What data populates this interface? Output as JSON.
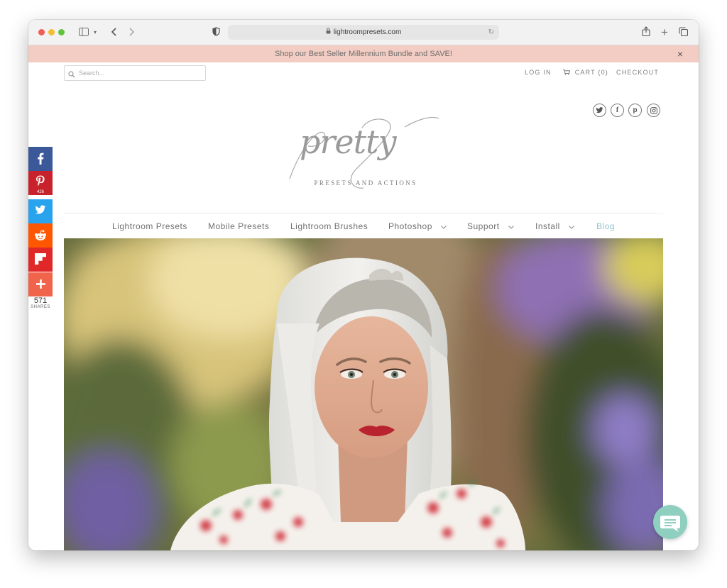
{
  "browser": {
    "url": "lightroompresets.com"
  },
  "promo": {
    "text": "Shop our Best Seller Millennium Bundle and SAVE!",
    "close_label": "×"
  },
  "header": {
    "search_placeholder": "Search...",
    "login": "LOG IN",
    "cart": "CART (0)",
    "checkout": "CHECKOUT",
    "social_icons": [
      "twitter-icon",
      "facebook-icon",
      "pinterest-icon",
      "instagram-icon"
    ]
  },
  "logo": {
    "script_text": "pretty",
    "tagline": "PRESETS AND ACTIONS"
  },
  "nav": {
    "items": [
      {
        "label": "Lightroom Presets",
        "has_dropdown": false
      },
      {
        "label": "Mobile Presets",
        "has_dropdown": false
      },
      {
        "label": "Lightroom Brushes",
        "has_dropdown": false
      },
      {
        "label": "Photoshop",
        "has_dropdown": true
      },
      {
        "label": "Support",
        "has_dropdown": true
      },
      {
        "label": "Install",
        "has_dropdown": true
      },
      {
        "label": "Blog",
        "has_dropdown": false
      }
    ]
  },
  "share_bar": {
    "buttons": [
      {
        "network": "facebook",
        "color": "#3b5998"
      },
      {
        "network": "pinterest",
        "color": "#c8232c",
        "count": "426"
      },
      {
        "network": "twitter",
        "color": "#2aa3ef"
      },
      {
        "network": "reddit",
        "color": "#ff5700"
      },
      {
        "network": "flipboard",
        "color": "#e12828"
      },
      {
        "network": "more",
        "color": "#f0644c"
      }
    ],
    "total": "571",
    "total_label": "SHARES"
  },
  "colors": {
    "promo_bg": "#f3cdc3",
    "nav_active": "#8fc3cc",
    "chat_bg": "#8fcfc0"
  }
}
